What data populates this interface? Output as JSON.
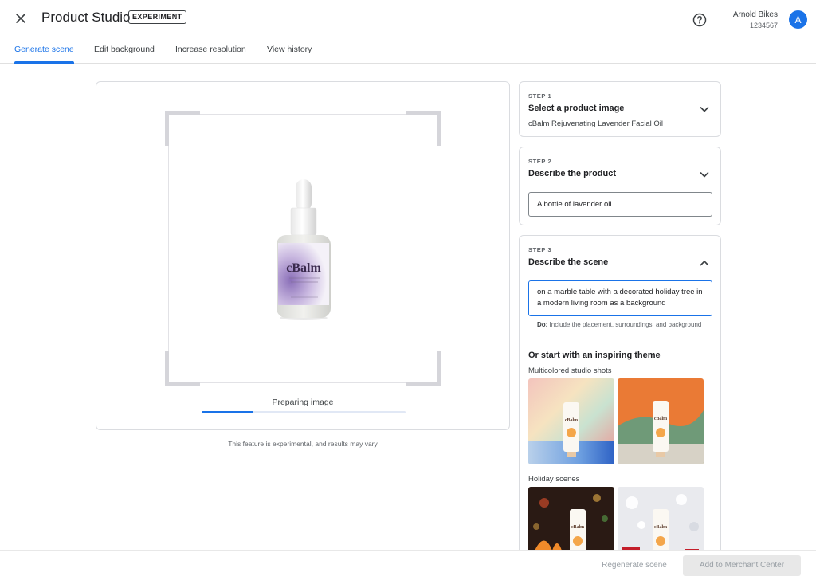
{
  "header": {
    "title": "Product Studio",
    "badge": "EXPERIMENT",
    "account_name": "Arnold Bikes",
    "account_id": "1234567",
    "avatar_initial": "A"
  },
  "tabs": [
    {
      "label": "Generate scene",
      "active": true
    },
    {
      "label": "Edit background",
      "active": false
    },
    {
      "label": "Increase resolution",
      "active": false
    },
    {
      "label": "View history",
      "active": false
    }
  ],
  "preview": {
    "brand_text": "cBalm",
    "status": "Preparing image",
    "progress": 0.25,
    "disclaimer": "This feature is experimental, and results may vary"
  },
  "steps": {
    "step1": {
      "label": "STEP 1",
      "title": "Select a product image",
      "value": "cBalm Rejuvenating Lavender Facial Oil"
    },
    "step2": {
      "label": "STEP 2",
      "title": "Describe the product",
      "value": "A bottle of lavender oil"
    },
    "step3": {
      "label": "STEP 3",
      "title": "Describe the scene",
      "value": "on a marble table with a decorated holiday tree in a modern living room as a background",
      "hint_bold": "Do:",
      "hint_text": " Include the placement, surroundings, and background",
      "themes_heading": "Or start with an inspiring theme",
      "groups": [
        {
          "label": "Multicolored studio shots"
        },
        {
          "label": "Holiday scenes"
        }
      ]
    }
  },
  "footer": {
    "regenerate_label": "Regenerate scene",
    "merchant_label": "Add to Merchant Center"
  },
  "colors": {
    "accent": "#1a73e8",
    "border": "#dadce0"
  }
}
